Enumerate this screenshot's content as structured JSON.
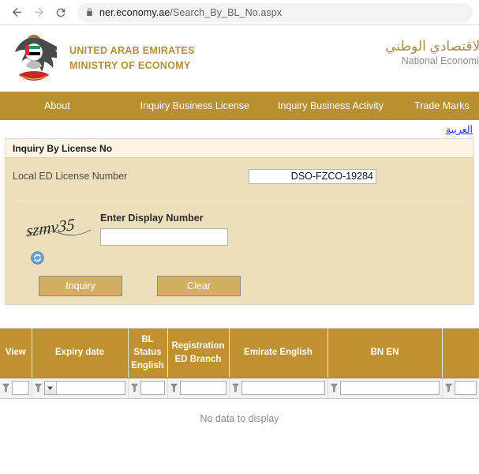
{
  "browser": {
    "back_icon": "arrow-left-icon",
    "forward_icon": "arrow-right-icon",
    "reload_icon": "reload-icon",
    "lock_icon": "lock-icon",
    "url_host": "ner.economy.ae",
    "url_path": "/Search_By_BL_No.aspx"
  },
  "header": {
    "emblem_alt": "uae-falcon-emblem",
    "brand_line1": "UNITED ARAB EMIRATES",
    "brand_line2": "MINISTRY OF ECONOMY",
    "brand_arabic": "الاقتصادي الوطني",
    "brand_sub": "National Economic",
    "brand_color": "#b08d3f"
  },
  "nav": {
    "background": "#b8902f",
    "items": [
      {
        "label": "About"
      },
      {
        "label": "Inquiry Business License"
      },
      {
        "label": "Inquiry Business Activity"
      },
      {
        "label": "Trade Marks"
      }
    ],
    "language_link": "العربية"
  },
  "form": {
    "panel_title": "Inquiry By License No",
    "license_label": "Local ED License Number",
    "license_value": "DSO-FZCO-19284",
    "license_placeholder": "",
    "captcha_text": "szmv35",
    "refresh_icon": "refresh-icon",
    "captcha_label": "Enter Display Number",
    "captcha_value": "",
    "captcha_placeholder": "",
    "inquiry_button": "Inquiry",
    "clear_button": "Clear",
    "panel_bg": "#ecdfbb",
    "button_bg": "#d2ae61"
  },
  "grid": {
    "header_bg": "#bf922f",
    "columns": [
      {
        "label": "View",
        "filter_type": "none"
      },
      {
        "label": "Expiry date",
        "filter_type": "select"
      },
      {
        "label": "BL\nStatus\nEnglish",
        "filter_type": "text"
      },
      {
        "label": "Registration\nED Branch",
        "filter_type": "text"
      },
      {
        "label": "Emirate English",
        "filter_type": "text"
      },
      {
        "label": "BN EN",
        "filter_type": "text"
      },
      {
        "label": "",
        "filter_type": "text"
      }
    ],
    "filter_values": [
      "",
      "",
      "",
      "",
      "",
      "",
      ""
    ],
    "filter_icon": "filter-funnel-icon",
    "rows": [],
    "empty_message": "No data to display"
  }
}
